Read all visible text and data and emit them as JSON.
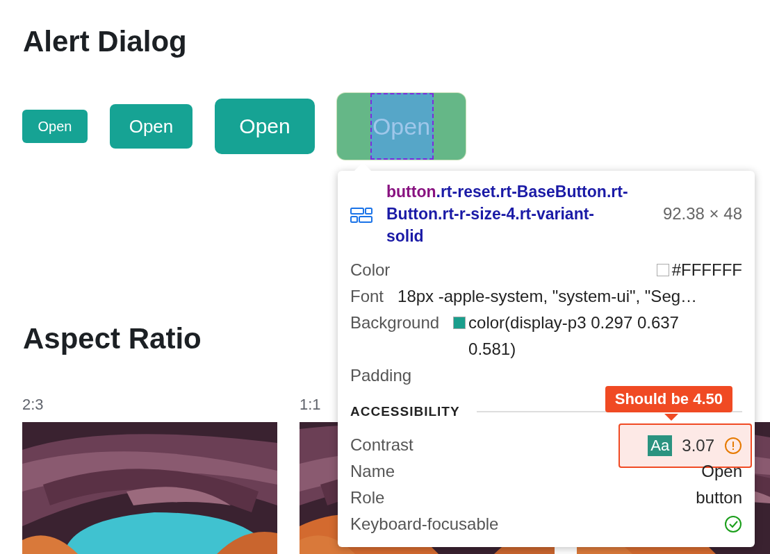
{
  "sections": [
    {
      "kind": "buttons",
      "title": "Alert Dialog",
      "buttons": [
        {
          "label": "Open",
          "highlighted": false
        },
        {
          "label": "Open",
          "highlighted": false
        },
        {
          "label": "Open",
          "highlighted": false
        },
        {
          "label": "Open",
          "highlighted": true
        }
      ]
    },
    {
      "kind": "pictures",
      "title": "Aspect Ratio",
      "items": [
        {
          "label": "2:3",
          "kind": "picture"
        },
        {
          "label": "1:1",
          "kind": "picture"
        },
        {
          "kind": "picture"
        }
      ]
    }
  ],
  "inspector": {
    "tag": "button",
    "classes": ".rt-reset.rt-BaseButton.rt-Button.rt-r-size-4.rt-variant-solid",
    "size": "92.38 × 48",
    "properties": [
      {
        "label": "Color",
        "value": "#FFFFFF",
        "color": "#ffffff"
      },
      {
        "label": "Font",
        "value": "18px -apple-system, \"system-ui\", \"Seg…"
      },
      {
        "label": "Background",
        "value": "color(display-p3 0.297 0.637 0.581)",
        "color": "#1a9e8c"
      },
      {
        "label": "Padding"
      }
    ],
    "accessibility_heading": "ACCESSIBILITY",
    "accessibility": [
      {
        "kind": "contrast",
        "label": "Contrast",
        "sample": "Aa",
        "value": "3.07",
        "passes": false,
        "hint": "Should be 4.50"
      },
      {
        "kind": "text",
        "label": "Name",
        "value": "Open"
      },
      {
        "kind": "text",
        "label": "Role",
        "value": "button"
      },
      {
        "kind": "check",
        "label": "Keyboard-focusable",
        "checked": true
      }
    ]
  }
}
